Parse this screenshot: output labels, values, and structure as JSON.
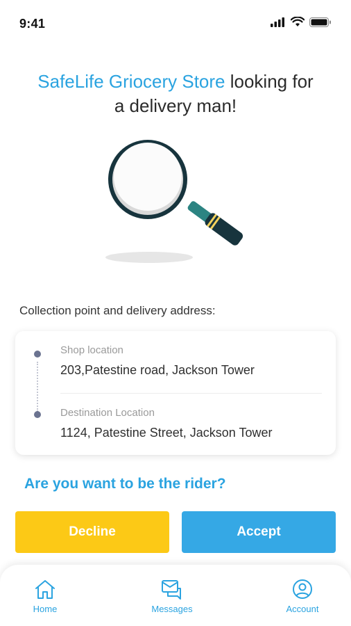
{
  "status": {
    "time": "9:41"
  },
  "headline": {
    "brand": "SafeLife Griocery Store",
    "rest_line1": " looking for",
    "line2": "a delivery man!"
  },
  "section": {
    "title": "Collection point and delivery address:"
  },
  "addresses": [
    {
      "label": "Shop location",
      "value": "203,Patestine road, Jackson Tower"
    },
    {
      "label": "Destination Location",
      "value": "1124, Patestine Street, Jackson Tower"
    }
  ],
  "question": "Are you want to be the rider?",
  "buttons": {
    "decline": "Decline",
    "accept": "Accept"
  },
  "tabs": [
    {
      "label": "Home",
      "icon": "home-icon"
    },
    {
      "label": "Messages",
      "icon": "messages-icon"
    },
    {
      "label": "Account",
      "icon": "account-icon"
    }
  ],
  "colors": {
    "brand_blue": "#2aa3e0",
    "decline_yellow": "#fcc916",
    "accept_blue": "#35a8e5"
  }
}
